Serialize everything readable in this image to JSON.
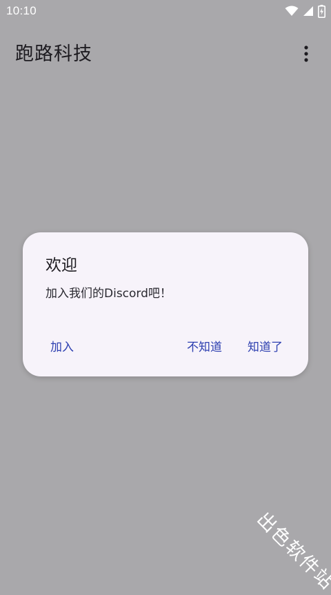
{
  "status_bar": {
    "time": "10:10",
    "icons": [
      "wifi-icon",
      "signal-icon",
      "battery-charging-icon"
    ]
  },
  "app_bar": {
    "title": "跑路科技",
    "menu_icon": "more-vert-icon"
  },
  "dialog": {
    "title": "欢迎",
    "message": "加入我们的Discord吧！",
    "buttons": {
      "join": "加入",
      "dunno": "不知道",
      "know": "知道了"
    }
  },
  "watermark": "出色软件站",
  "colors": {
    "scrim_background": "#a9a8ab",
    "dialog_background": "#f7f3fa",
    "button_text": "#2d3fb0"
  }
}
